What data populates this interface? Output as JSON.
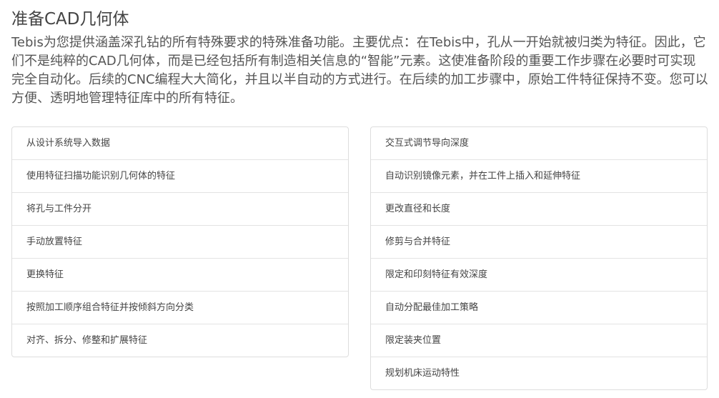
{
  "header": {
    "title": "准备CAD几何体"
  },
  "intro": {
    "paragraph": "Tebis为您提供涵盖深孔钻的所有特殊要求的特殊准备功能。主要优点：在Tebis中，孔从一开始就被归类为特征。因此，它们不是纯粹的CAD几何体，而是已经包括所有制造相关信息的“智能”元素。这使准备阶段的重要工作步骤在必要时可实现完全自动化。后续的CNC编程大大简化，并且以半自动的方式进行。在后续的加工步骤中，原始工件特征保持不变。您可以方便、透明地管理特征库中的所有特征。"
  },
  "left_list": {
    "items": [
      "从设计系统导入数据",
      "使用特征扫描功能识别几何体的特征",
      "将孔与工件分开",
      "手动放置特征",
      "更换特征",
      "按照加工顺序组合特征并按倾斜方向分类",
      "对齐、拆分、修整和扩展特征"
    ]
  },
  "right_list": {
    "items": [
      "交互式调节导向深度",
      "自动识别镜像元素，并在工件上插入和延伸特征",
      "更改直径和长度",
      "修剪与合并特征",
      "限定和印刻特征有效深度",
      "自动分配最佳加工策略",
      "限定装夹位置",
      "规划机床运动特性"
    ]
  }
}
